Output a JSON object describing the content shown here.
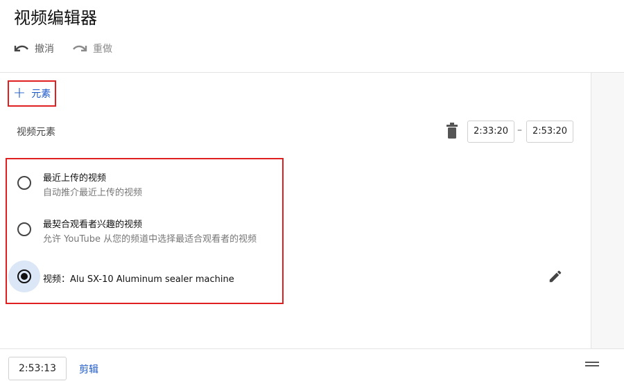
{
  "header": {
    "title": "视频编辑器"
  },
  "toolbar": {
    "undo_label": "撤消",
    "redo_label": "重做"
  },
  "editor": {
    "add_element_label": "元素",
    "section_label": "视频元素",
    "start_time": "2:33:20",
    "end_time": "2:53:20",
    "range_separator": "–",
    "options": [
      {
        "title": "最近上传的视频",
        "subtitle": "自动推介最近上传的视频",
        "selected": false
      },
      {
        "title": "最契合观看者兴趣的视频",
        "subtitle": "允许 YouTube 从您的频道中选择最适合观看者的视频",
        "selected": false
      },
      {
        "title": "视频：Alu SX-10 Aluminum sealer machine",
        "subtitle": "",
        "selected": true
      }
    ]
  },
  "footer": {
    "current_time": "2:53:13",
    "trim_label": "剪辑"
  },
  "colors": {
    "accent": "#1a57c9",
    "highlight_border": "#e02020",
    "selected_bg": "#dbe7f7"
  },
  "icons": {
    "undo": "undo-icon",
    "redo": "redo-icon",
    "delete": "trash-icon",
    "edit": "pencil-icon",
    "menu": "menu-icon",
    "add": "plus-icon"
  }
}
